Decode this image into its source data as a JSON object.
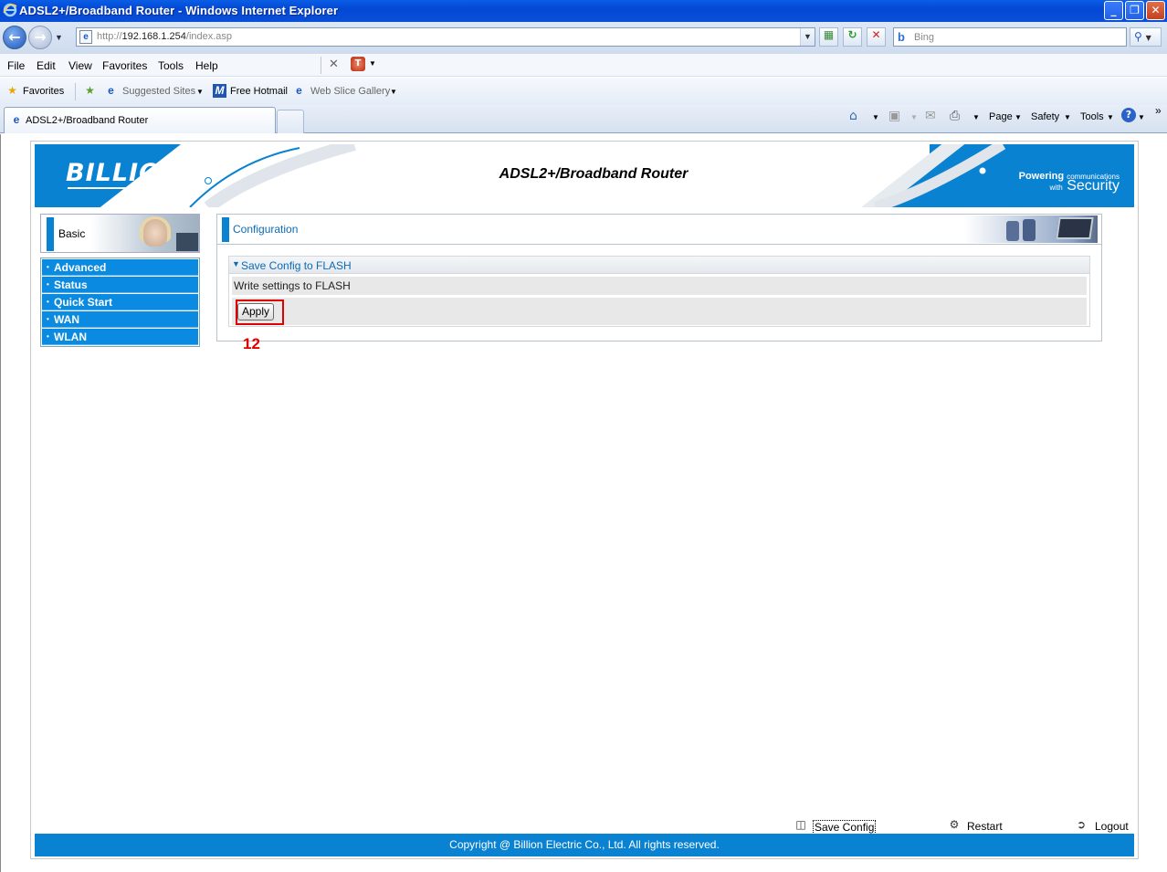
{
  "window": {
    "title": "ADSL2+/Broadband Router - Windows Internet Explorer",
    "minimize": "_",
    "restore": "❐",
    "close": "✕"
  },
  "address": {
    "url_prefix": "http://",
    "url_host": "192.168.1.254",
    "url_path": "/index.asp",
    "search_placeholder": "Bing"
  },
  "menu": [
    "File",
    "Edit",
    "View",
    "Favorites",
    "Tools",
    "Help"
  ],
  "favorites": {
    "favorites_label": "Favorites",
    "suggested_sites": "Suggested Sites",
    "free_hotmail": "Free Hotmail",
    "web_slice_gallery": "Web Slice Gallery"
  },
  "tab": {
    "title": "ADSL2+/Broadband Router"
  },
  "commands": {
    "page": "Page",
    "safety": "Safety",
    "tools": "Tools"
  },
  "banner": {
    "logo": "BILLION",
    "product": "ADSL2+/Broadband Router",
    "tag_powering": "Powering",
    "tag_communications": "communications",
    "tag_with": "with",
    "tag_security": "Security"
  },
  "sidebar": {
    "basic_label": "Basic",
    "items": [
      "Advanced",
      "Status",
      "Quick Start",
      "WAN",
      "WLAN"
    ]
  },
  "main": {
    "panel_title": "Configuration",
    "section_title": "Save Config to FLASH",
    "row_label": "Write settings to FLASH",
    "apply_label": "Apply",
    "annotation": "12"
  },
  "footer": {
    "save_config": "Save Config",
    "restart": "Restart",
    "logout": "Logout",
    "copyright": "Copyright @ Billion Electric Co., Ltd. All rights reserved."
  },
  "colors": {
    "brand_blue": "#0a82d2",
    "highlight_red": "#e00000",
    "xp_titlebar": "#0348d4"
  },
  "icons": [
    "ie-icon",
    "back-arrow-icon",
    "forward-arrow-icon",
    "compat-view-icon",
    "refresh-icon",
    "stop-icon",
    "bing-icon",
    "search-icon",
    "translate-icon",
    "favorites-star-icon",
    "add-favorites-icon",
    "hotmail-icon",
    "home-icon",
    "rss-icon",
    "mail-icon",
    "print-icon",
    "help-icon",
    "save-disk-icon",
    "restart-icon",
    "logout-icon"
  ]
}
